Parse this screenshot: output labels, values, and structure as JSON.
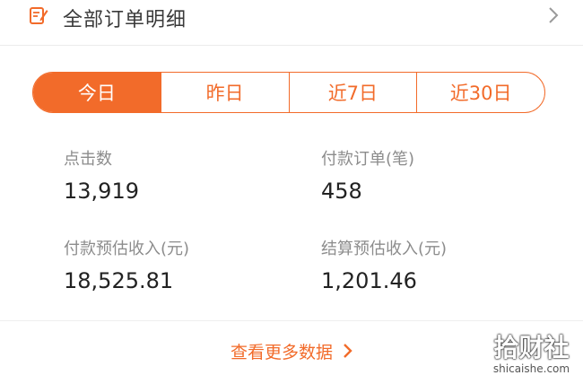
{
  "header": {
    "title": "全部订单明细",
    "icon": "order-edit-icon",
    "chevron_icon": "chevron-right-icon"
  },
  "tabs": [
    {
      "label": "今日",
      "active": true
    },
    {
      "label": "昨日",
      "active": false
    },
    {
      "label": "近7日",
      "active": false
    },
    {
      "label": "近30日",
      "active": false
    }
  ],
  "stats": [
    {
      "label": "点击数",
      "value": "13,919"
    },
    {
      "label": "付款订单(笔)",
      "value": "458"
    },
    {
      "label": "付款预估收入(元)",
      "value": "18,525.81"
    },
    {
      "label": "结算预估收入(元)",
      "value": "1,201.46"
    }
  ],
  "footer": {
    "more_label": "查看更多数据",
    "chevron_icon": "chevron-right-icon"
  },
  "watermark": {
    "main": "拾财社",
    "sub": "shicaishe.com"
  },
  "colors": {
    "accent": "#f26b2a",
    "label": "#8c8c8c",
    "value": "#222222"
  }
}
